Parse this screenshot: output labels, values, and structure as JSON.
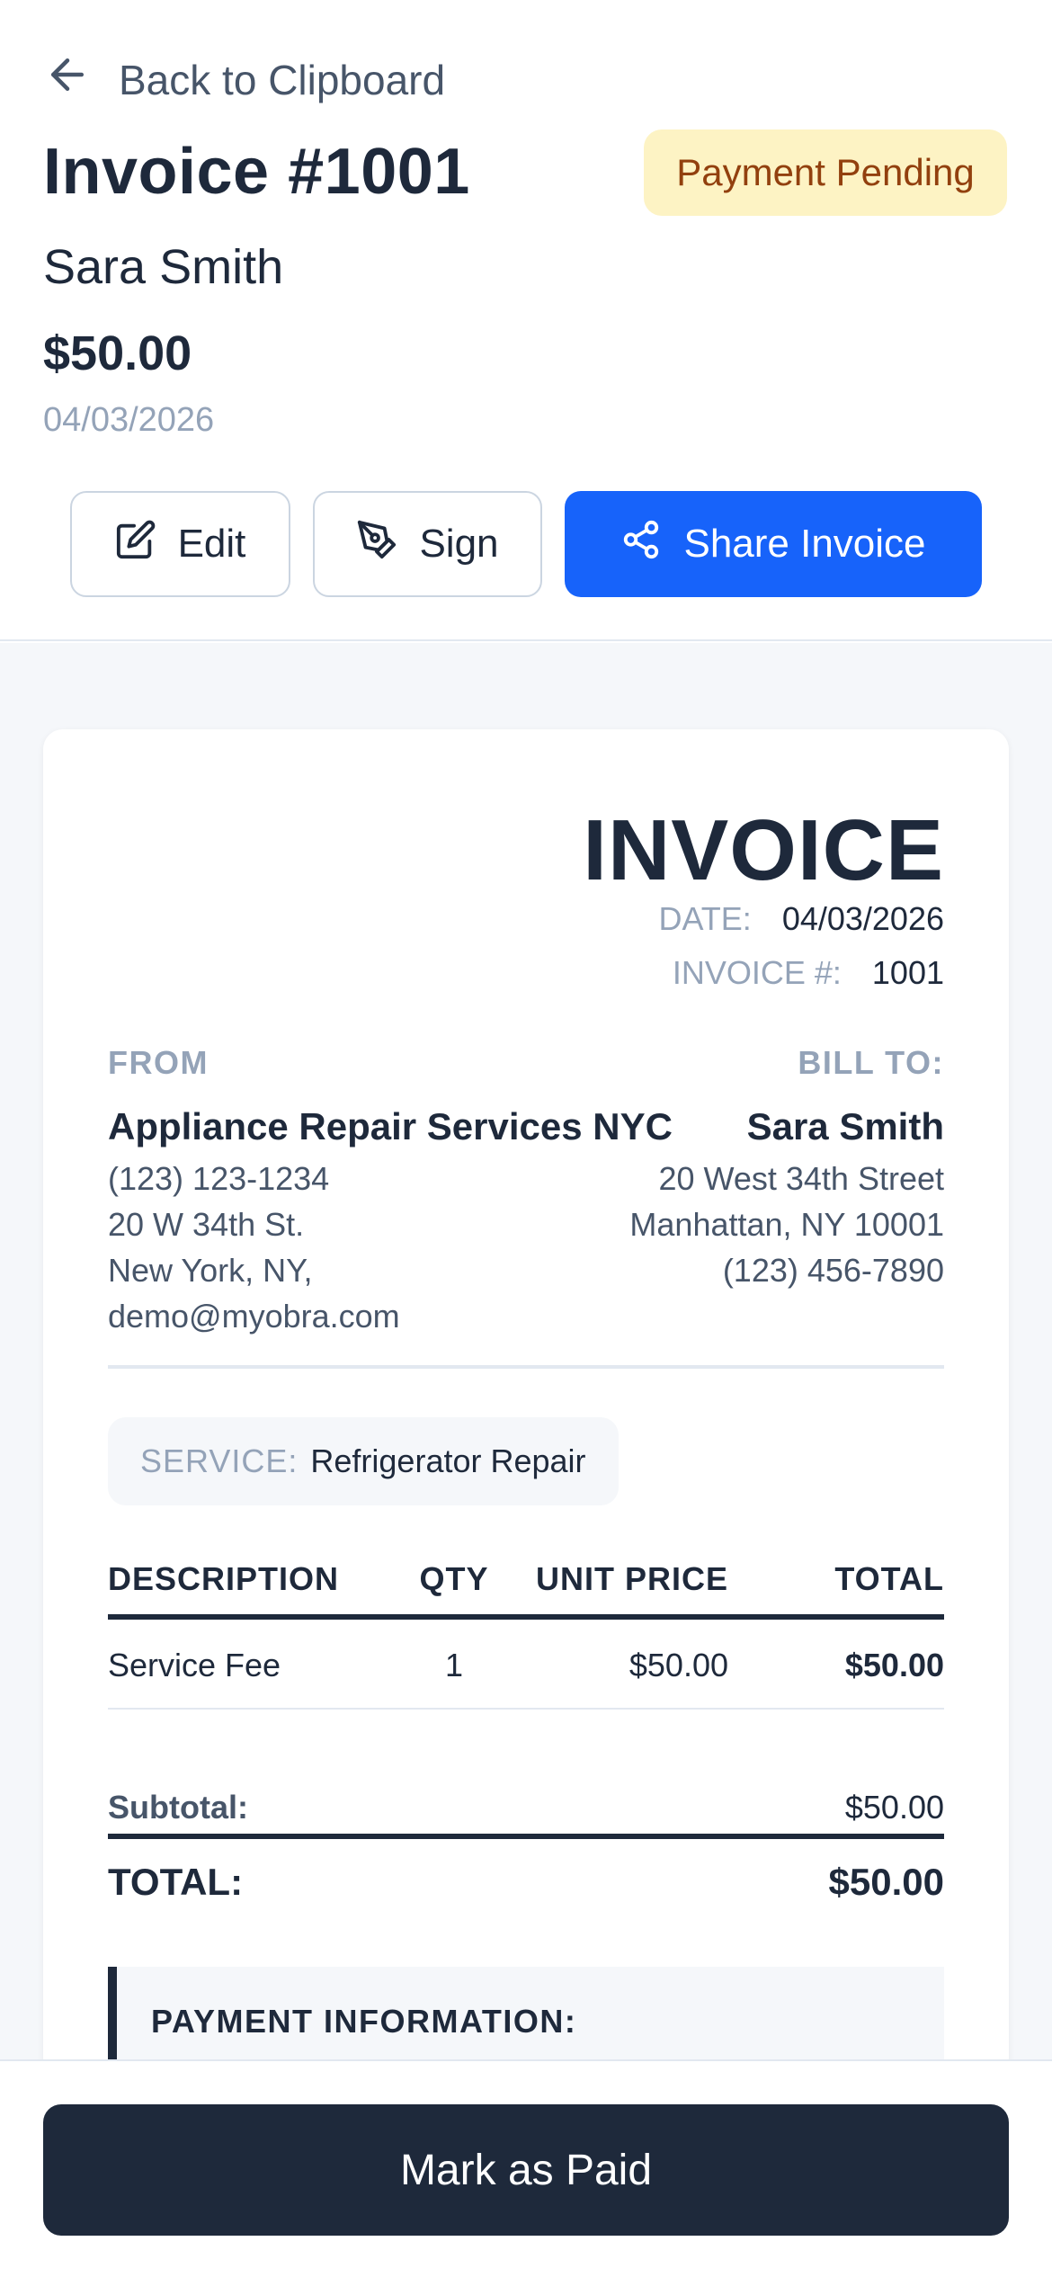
{
  "header": {
    "back_label": "Back to Clipboard",
    "title": "Invoice #1001",
    "status": "Payment Pending",
    "client_name": "Sara Smith",
    "amount": "$50.00",
    "date": "04/03/2026",
    "actions": {
      "edit_label": "Edit",
      "sign_label": "Sign",
      "share_label": "Share Invoice"
    }
  },
  "invoice": {
    "heading": "INVOICE",
    "date_label": "DATE:",
    "date_value": "04/03/2026",
    "number_label": "INVOICE #:",
    "number_value": "1001",
    "from": {
      "label": "FROM",
      "name": "Appliance Repair Services NYC",
      "phone": "(123) 123-1234",
      "address1": "20 W 34th St.",
      "address2": "New York, NY,",
      "email": "demo@myobra.com"
    },
    "bill_to": {
      "label": "BILL TO:",
      "name": "Sara Smith",
      "address1": "20 West 34th Street",
      "address2": "Manhattan, NY 10001",
      "phone": "(123) 456-7890"
    },
    "service": {
      "label": "SERVICE:",
      "value": "Refrigerator Repair"
    },
    "table": {
      "headers": {
        "description": "DESCRIPTION",
        "qty": "QTY",
        "unit_price": "UNIT PRICE",
        "total": "TOTAL"
      },
      "rows": [
        {
          "description": "Service Fee",
          "qty": "1",
          "unit_price": "$50.00",
          "total": "$50.00"
        }
      ]
    },
    "subtotal_label": "Subtotal:",
    "subtotal_value": "$50.00",
    "total_label": "TOTAL:",
    "total_value": "$50.00",
    "payment_info_label": "PAYMENT INFORMATION:"
  },
  "footer": {
    "mark_paid_label": "Mark as Paid"
  },
  "colors": {
    "primary": "#1763fa",
    "dark": "#1e293b",
    "pending_bg": "#fdf3c4",
    "pending_text": "#92400e",
    "muted": "#94a3b8"
  },
  "icons": [
    "arrow-left-icon",
    "edit-icon",
    "pen-tool-icon",
    "share-icon"
  ]
}
